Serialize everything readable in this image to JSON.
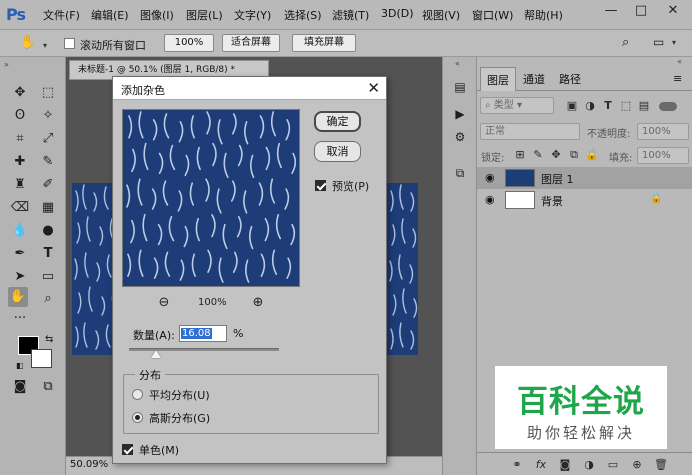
{
  "app": {
    "logo": "Ps"
  },
  "menu": [
    "文件(F)",
    "编辑(E)",
    "图像(I)",
    "图层(L)",
    "文字(Y)",
    "选择(S)",
    "滤镜(T)",
    "3D(D)",
    "视图(V)",
    "窗口(W)",
    "帮助(H)"
  ],
  "options_bar": {
    "scroll_all_label": "滚动所有窗口",
    "scroll_all_checked": false,
    "zoom_100": "100%",
    "fit_screen": "适合屏幕",
    "fill_screen": "填充屏幕"
  },
  "document": {
    "tab_title": "未标题-1 @ 50.1% (图层 1, RGB/8) *",
    "status_zoom": "50.09%"
  },
  "dialog": {
    "title": "添加杂色",
    "ok": "确定",
    "cancel": "取消",
    "preview_label": "预览(P)",
    "preview_checked": true,
    "zoom": "100%",
    "amount_label": "数量(A):",
    "amount_value": "16.08",
    "amount_unit": "%",
    "distribution_label": "分布",
    "uniform_label": "平均分布(U)",
    "gaussian_label": "高斯分布(G)",
    "distribution_selected": "gaussian",
    "monochrome_label": "单色(M)",
    "monochrome_checked": true
  },
  "layers_panel": {
    "tabs": [
      "图层",
      "通道",
      "路径"
    ],
    "active_tab": "图层",
    "kind_filter": "类型",
    "blend_mode": "正常",
    "opacity_label": "不透明度:",
    "opacity_value": "100%",
    "lock_label": "锁定:",
    "fill_label": "填充:",
    "fill_value": "100%",
    "layers": [
      {
        "name": "图层 1",
        "selected": true
      },
      {
        "name": "背景",
        "selected": false,
        "locked": true
      }
    ]
  },
  "watermark": {
    "title": "百科全说",
    "subtitle": "助你轻松解决"
  },
  "colors": {
    "accent": "#1fa64a",
    "selection": "#2f6fd1",
    "texture": "#1d3c78"
  }
}
